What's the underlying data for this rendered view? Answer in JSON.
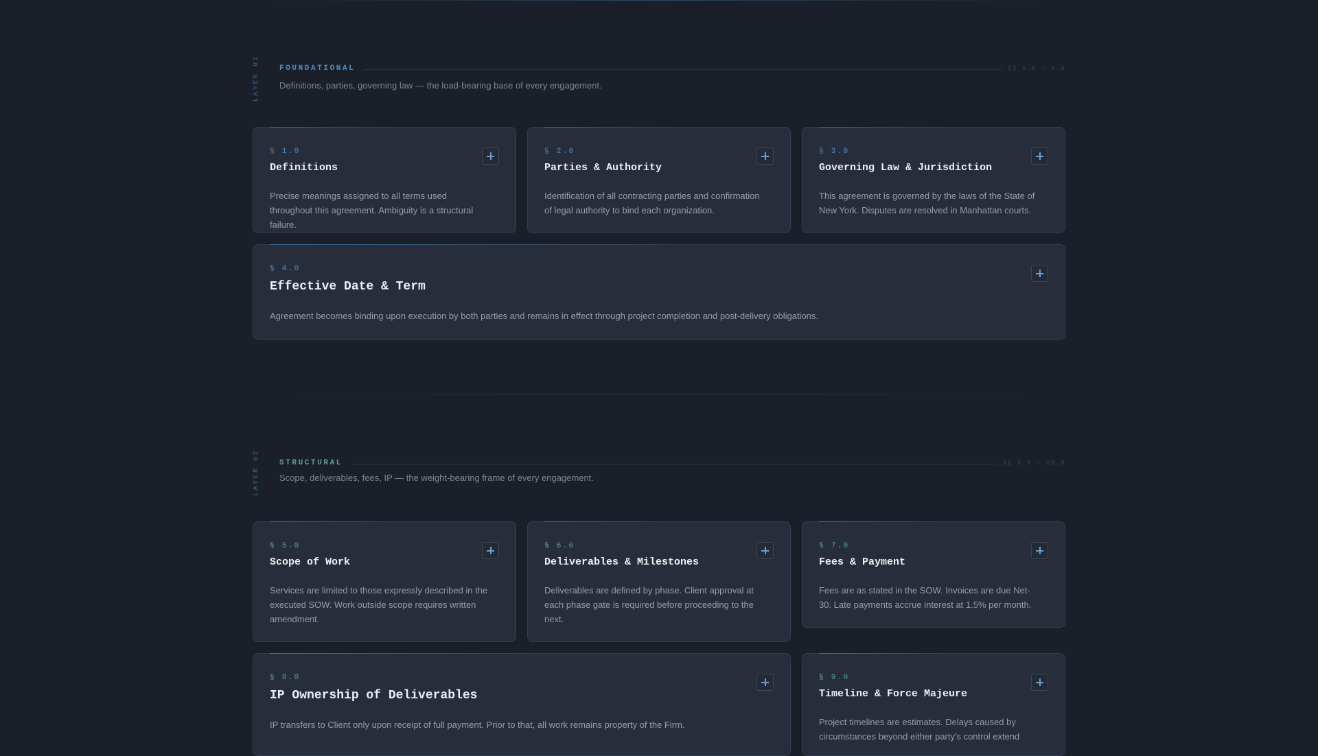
{
  "colors": {
    "background": "#1b1f29",
    "card": "#272d3a",
    "accent_blue": "#4f8fc7",
    "accent_teal": "#5aa6a0"
  },
  "layers": [
    {
      "tag": "LAYER 01",
      "name": "FOUNDATIONAL",
      "range": "§§ 1.0 — 4.0",
      "description": "Definitions, parties, governing law — the load-bearing base of every engagement.",
      "sections": [
        {
          "number": "§ 1.0",
          "title": "Definitions",
          "body": "Precise meanings assigned to all terms used throughout this agreement. Ambiguity is a structural failure.",
          "icon": "plus-icon"
        },
        {
          "number": "§ 2.0",
          "title": "Parties & Authority",
          "body": "Identification of all contracting parties and confirmation of legal authority to bind each organization.",
          "icon": "plus-icon"
        },
        {
          "number": "§ 3.0",
          "title": "Governing Law & Jurisdiction",
          "body": "This agreement is governed by the laws of the State of New York. Disputes are resolved in Manhattan courts.",
          "icon": "plus-icon"
        },
        {
          "number": "§ 4.0",
          "title": "Effective Date & Term",
          "body": "Agreement becomes binding upon execution by both parties and remains in effect through project completion and post-delivery obligations.",
          "icon": "plus-icon"
        }
      ]
    },
    {
      "tag": "LAYER 02",
      "name": "STRUCTURAL",
      "range": "§§ 5.0 — 10.0",
      "description": "Scope, deliverables, fees, IP — the weight-bearing frame of every engagement.",
      "sections": [
        {
          "number": "§ 5.0",
          "title": "Scope of Work",
          "body": "Services are limited to those expressly described in the executed SOW. Work outside scope requires written amendment.",
          "icon": "plus-icon"
        },
        {
          "number": "§ 6.0",
          "title": "Deliverables & Milestones",
          "body": "Deliverables are defined by phase. Client approval at each phase gate is required before proceeding to the next.",
          "icon": "plus-icon"
        },
        {
          "number": "§ 7.0",
          "title": "Fees & Payment",
          "body": "Fees are as stated in the SOW. Invoices are due Net-30. Late payments accrue interest at 1.5% per month.",
          "icon": "plus-icon"
        },
        {
          "number": "§ 8.0",
          "title": "IP Ownership of Deliverables",
          "body": "IP transfers to Client only upon receipt of full payment. Prior to that, all work remains property of the Firm.",
          "icon": "plus-icon"
        },
        {
          "number": "§ 9.0",
          "title": "Timeline & Force Majeure",
          "body": "Project timelines are estimates. Delays caused by circumstances beyond either party's control extend",
          "icon": "plus-icon"
        }
      ]
    }
  ]
}
